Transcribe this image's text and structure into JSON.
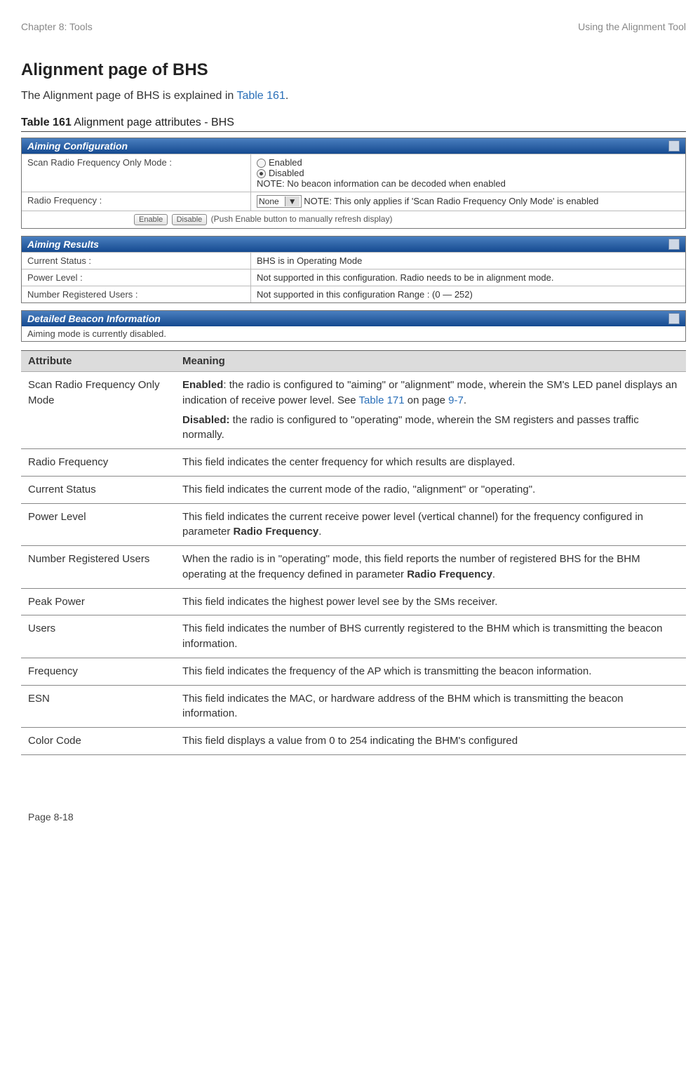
{
  "header": {
    "left": "Chapter 8:  Tools",
    "right": "Using the Alignment Tool"
  },
  "title": "Alignment page of BHS",
  "intro_prefix": "The Alignment page of BHS is explained in ",
  "intro_link": "Table 161",
  "intro_suffix": ".",
  "caption_bold": "Table 161",
  "caption_rest": " Alignment page attributes - BHS",
  "aiming_config": {
    "panel_title": "Aiming Configuration",
    "row1_label": "Scan Radio Frequency Only Mode :",
    "opt_enabled": "Enabled",
    "opt_disabled": "Disabled",
    "note1": "NOTE: No beacon information can be decoded when enabled",
    "row2_label": "Radio Frequency :",
    "select_value": "None",
    "note2": "NOTE: This only applies if 'Scan Radio Frequency Only Mode' is enabled",
    "btn_enable": "Enable",
    "btn_disable": "Disable",
    "push_note": "(Push Enable button to manually refresh display)"
  },
  "aiming_results": {
    "panel_title": "Aiming Results",
    "r1_label": "Current Status :",
    "r1_value": "BHS is in Operating Mode",
    "r2_label": "Power Level :",
    "r2_value": "Not supported in this configuration. Radio needs to be in alignment mode.",
    "r3_label": "Number Registered Users :",
    "r3_value": "Not supported in this configuration Range : (0 — 252)"
  },
  "beacon": {
    "panel_title": "Detailed Beacon Information",
    "sub": "Aiming mode is currently disabled."
  },
  "attr_headers": {
    "c1": "Attribute",
    "c2": "Meaning"
  },
  "rows": {
    "r1": {
      "attr": "Scan Radio Frequency Only Mode",
      "enabled_label": "Enabled",
      "enabled_text": ": the radio is configured to \"aiming\" or \"alignment\" mode, wherein the SM's LED panel displays an indication of receive power level. See ",
      "link1": "Table 171",
      "mid": " on page ",
      "link2": "9-7",
      "enabled_end": ".",
      "disabled_label": "Disabled:",
      "disabled_text": " the radio is configured to \"operating\" mode, wherein the SM registers and passes traffic normally."
    },
    "r2": {
      "attr": "Radio Frequency",
      "meaning": "This field indicates the center frequency for which results are displayed."
    },
    "r3": {
      "attr": "Current Status",
      "meaning": "This field indicates the current mode of the radio, \"alignment\" or \"operating\"."
    },
    "r4": {
      "attr": "Power Level",
      "pre": "This field indicates the current receive power level (vertical channel) for the frequency configured in parameter ",
      "bold": "Radio Frequency",
      "post": "."
    },
    "r5": {
      "attr": "Number Registered Users",
      "pre": "When the radio is in \"operating\" mode, this field reports the number of registered BHS for the BHM operating at the frequency defined in parameter ",
      "bold": "Radio Frequency",
      "post": "."
    },
    "r6": {
      "attr": "Peak Power",
      "meaning": "This field indicates the highest power level see by the SMs receiver."
    },
    "r7": {
      "attr": "Users",
      "meaning": "This field indicates the number of BHS currently registered to the BHM which is transmitting the beacon information."
    },
    "r8": {
      "attr": "Frequency",
      "meaning": "This field indicates the frequency of the AP which is transmitting the beacon information."
    },
    "r9": {
      "attr": "ESN",
      "meaning": "This field indicates the MAC, or hardware address of the BHM which is transmitting the beacon information."
    },
    "r10": {
      "attr": "Color Code",
      "meaning": "This field displays a value from 0 to 254 indicating the BHM's configured"
    }
  },
  "footer": "Page 8-18"
}
